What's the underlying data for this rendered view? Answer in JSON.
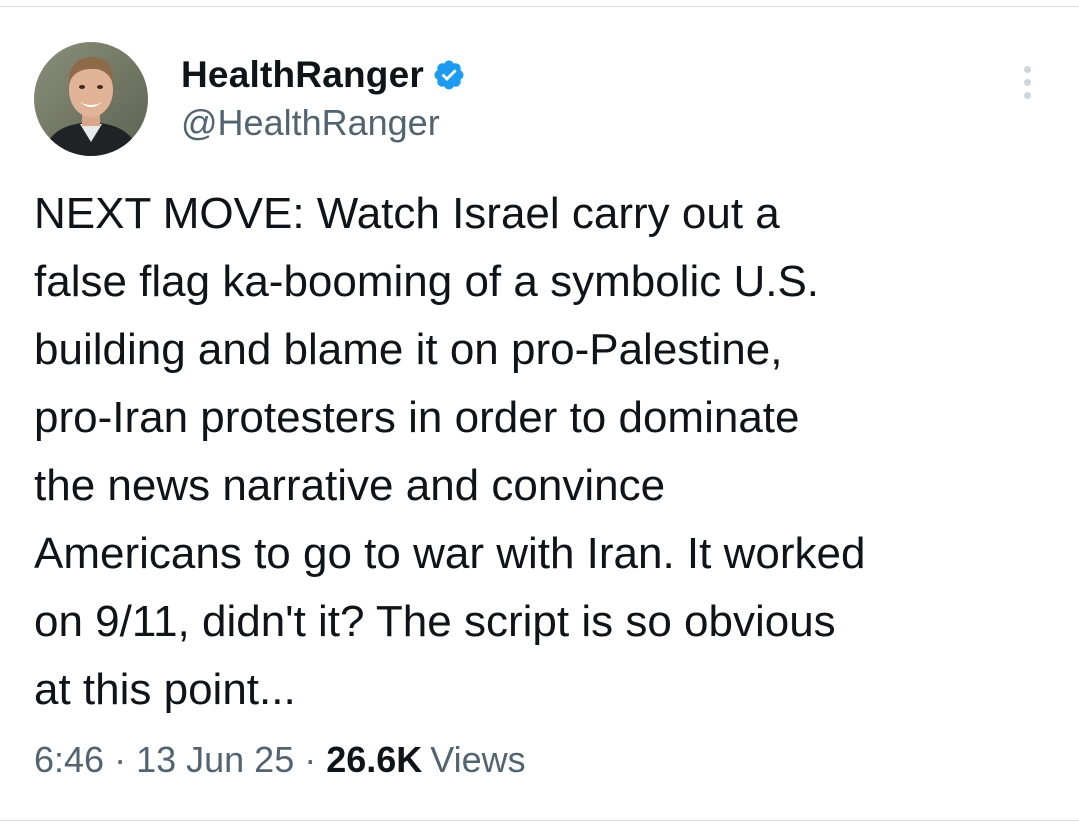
{
  "author": {
    "display_name": "HealthRanger",
    "handle": "@HealthRanger",
    "verified": true,
    "verified_color": "#1d9bf0"
  },
  "tweet": {
    "text": "NEXT MOVE: Watch Israel carry out a\nfalse flag ka-booming of a symbolic U.S.\nbuilding and blame it on pro-Palestine,\npro-Iran protesters in order to dominate\nthe news narrative and convince\nAmericans to go to war with Iran. It worked\non 9/11, didn't it? The script is so obvious\nat this point..."
  },
  "meta": {
    "time": "6:46",
    "separator": "·",
    "date": "13 Jun 25",
    "views_count": "26.6K",
    "views_label": "Views"
  },
  "icons": {
    "verified": "verified-badge-icon",
    "more": "more-options-icon"
  }
}
